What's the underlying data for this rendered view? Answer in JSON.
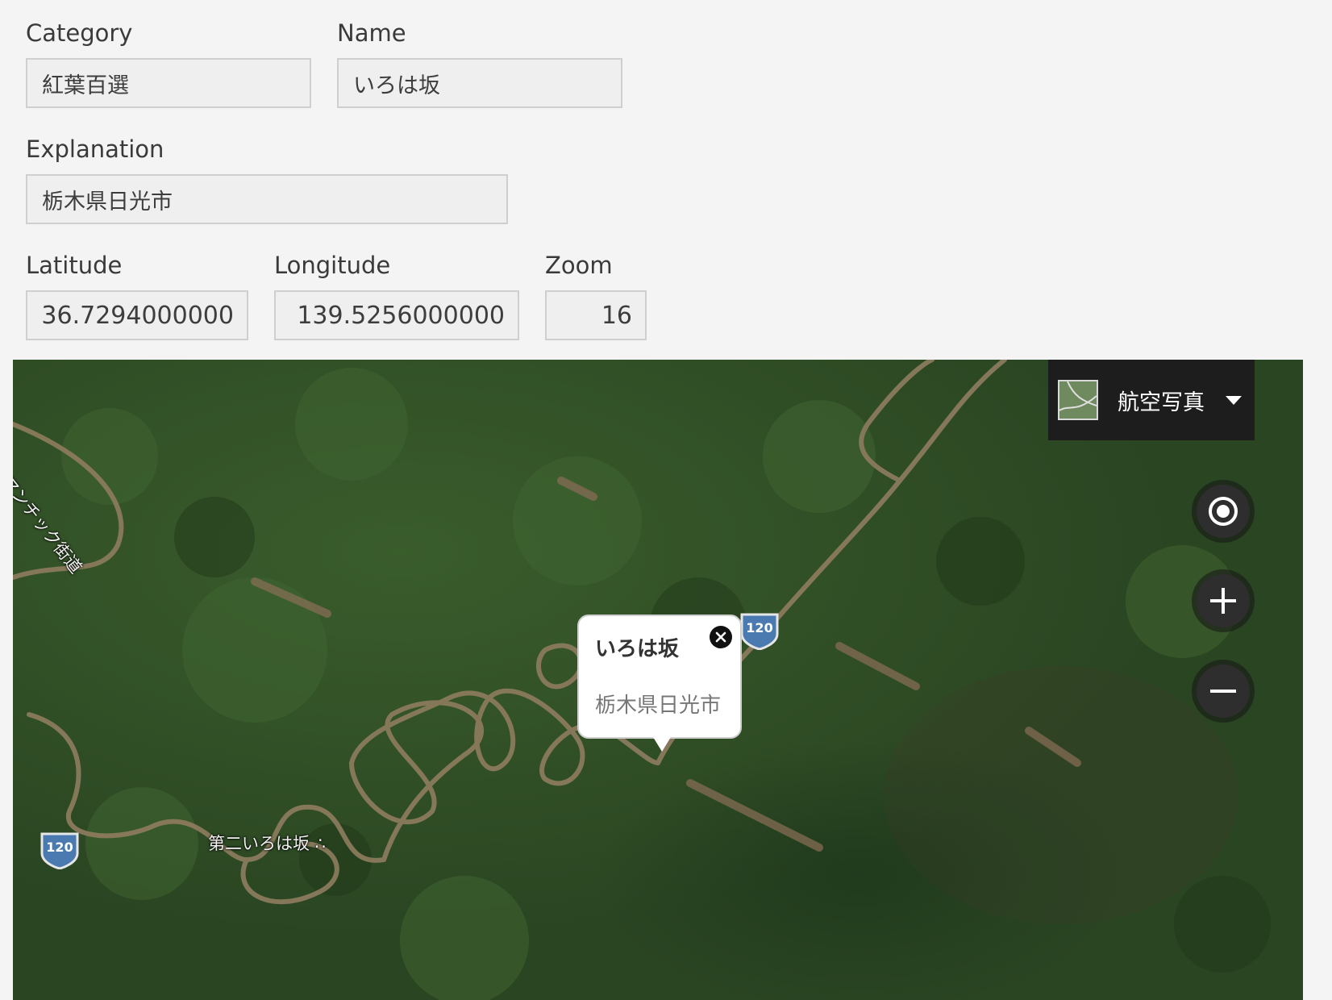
{
  "form": {
    "category": {
      "label": "Category",
      "value": "紅葉百選"
    },
    "name": {
      "label": "Name",
      "value": "いろは坂"
    },
    "explanation": {
      "label": "Explanation",
      "value": "栃木県日光市"
    },
    "latitude": {
      "label": "Latitude",
      "value": "36.7294000000"
    },
    "longitude": {
      "label": "Longitude",
      "value": "139.5256000000"
    },
    "zoom": {
      "label": "Zoom",
      "value": "16"
    }
  },
  "map": {
    "map_type": {
      "label": "航空写真",
      "icon": "aerial-thumbnail-icon"
    },
    "controls": {
      "locate": "locate-icon",
      "zoom_in": "plus-icon",
      "zoom_out": "minus-icon"
    },
    "popup": {
      "title": "いろは坂",
      "body": "栃木県日光市"
    },
    "labels": {
      "place_poi": "第二いろは坂 ∴",
      "road_name": "ロマンチック街道",
      "route_number": "120"
    },
    "colors": {
      "forest": "#2d4b24",
      "road": "#8a7a5c",
      "control_bg": "#1d1d1d"
    }
  }
}
